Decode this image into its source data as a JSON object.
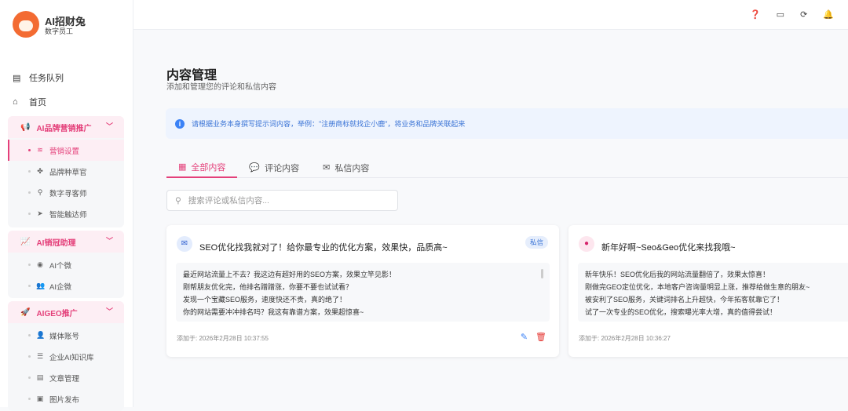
{
  "brand": {
    "name": "AI招财兔",
    "subtitle": "数字员工"
  },
  "nav": {
    "top": [
      {
        "label": "任务队列",
        "icon": "list-icon"
      },
      {
        "label": "首页",
        "icon": "home-icon"
      }
    ],
    "groups": [
      {
        "label": "AI品牌营销推广",
        "icon": "megaphone-icon",
        "items": [
          {
            "label": "营销设置",
            "icon": "layers-icon",
            "active": true
          },
          {
            "label": "品牌种草官",
            "icon": "seedling-icon"
          },
          {
            "label": "数字寻客师",
            "icon": "search-icon"
          },
          {
            "label": "智能触达师",
            "icon": "send-icon"
          }
        ]
      },
      {
        "label": "AI销冠助理",
        "icon": "chart-line-icon",
        "items": [
          {
            "label": "AI个微",
            "icon": "user-circle-icon"
          },
          {
            "label": "AI企微",
            "icon": "users-icon"
          }
        ]
      },
      {
        "label": "AIGEO推广",
        "icon": "rocket-icon",
        "items": [
          {
            "label": "媒体账号",
            "icon": "user-icon"
          },
          {
            "label": "企业AI知识库",
            "icon": "database-icon"
          },
          {
            "label": "文章管理",
            "icon": "article-icon"
          },
          {
            "label": "图片发布",
            "icon": "image-icon"
          }
        ]
      }
    ]
  },
  "page": {
    "title": "内容管理",
    "subtitle": "添加和管理您的评论和私信内容",
    "banner": "请根据业务本身撰写提示词内容，举例：\"注册商标就找企小鹿\"，将业务和品牌关联起来",
    "tabs": [
      {
        "label": "全部内容",
        "icon": "grid-icon"
      },
      {
        "label": "评论内容",
        "icon": "comment-icon"
      },
      {
        "label": "私信内容",
        "icon": "envelope-icon"
      }
    ],
    "search_placeholder": "搜索评论或私信内容..."
  },
  "cards": [
    {
      "title": "SEO优化找我就对了！给你最专业的优化方案，效果快，品质高~",
      "badge": "私信",
      "lines": [
        "最近网站流量上不去？我这边有超好用的SEO方案，效果立竿见影！",
        "刚帮朋友优化完，他排名蹭蹭涨，你要不要也试试看？",
        "发现一个宝藏SEO服务，速度快还不贵，真的绝了！",
        "你的网站需要冲冲排名吗？我这有靠谱方案，效果超惊喜~"
      ],
      "added": "添加于: 2026年2月28日 10:37:55"
    },
    {
      "title": "新年好啊~Seo&Geo优化来找我哦~",
      "lines": [
        "新年快乐！SEO优化后我的网站流量翻倍了，效果太惊喜！",
        "刚做完GEO定位优化，本地客户咨询量明显上涨，推荐给做生意的朋友~",
        "被安利了SEO服务，关键词排名上升超快，今年拓客就靠它了！",
        "试了一次专业的SEO优化，搜索曝光率大增，真的值得尝试！"
      ],
      "added": "添加于: 2026年2月28日 10:36:27"
    }
  ],
  "colors": {
    "accent": "#e4407a",
    "info": "#3b74d6"
  }
}
